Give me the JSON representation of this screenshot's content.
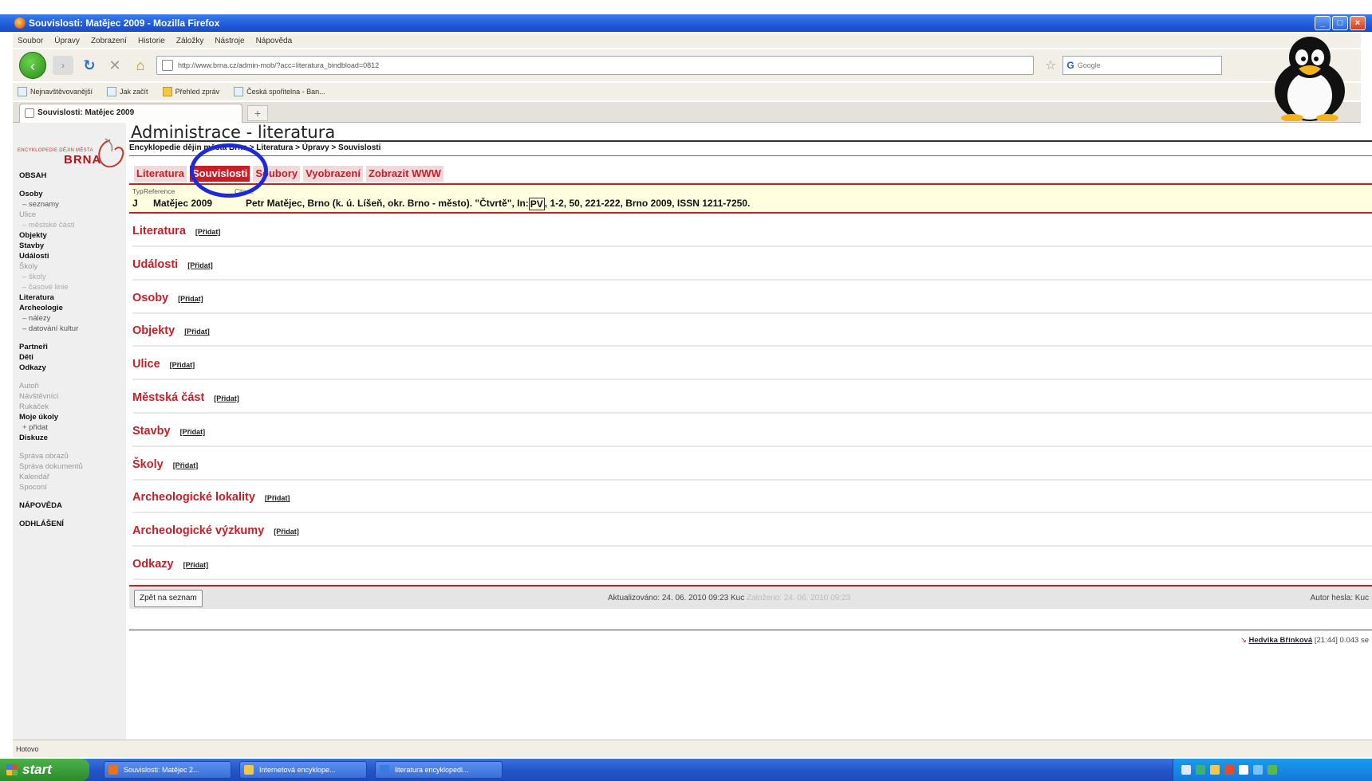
{
  "window": {
    "title": "Souvislosti: Matějec 2009 - Mozilla Firefox",
    "buttons": [
      "_",
      "□",
      "×"
    ]
  },
  "menu": [
    "Soubor",
    "Úpravy",
    "Zobrazení",
    "Historie",
    "Záložky",
    "Nástroje",
    "Nápověda"
  ],
  "navbar": {
    "url": "http://www.brna.cz/admin-mob/?acc=literatura_bindbload=0812",
    "search_placeholder": "Google"
  },
  "bookmarks": [
    "Nejnavštěvovanější",
    "Jak začít",
    "Přehled zpráv",
    "Česká spořitelna - Ban..."
  ],
  "browser_tab": {
    "label": "Souvislosti: Matějec 2009",
    "new_tab": "+"
  },
  "logo": {
    "small": "ENCYKLOPEDIE DĚJIN MĚSTA",
    "brand": "BRNA"
  },
  "sidebar": [
    {
      "label": "OBSAH",
      "style": "b",
      "gap": false
    },
    {
      "label": "Osoby",
      "style": "b",
      "gap": true
    },
    {
      "label": "– seznamy",
      "style": "sub",
      "gap": false
    },
    {
      "label": "Ulice",
      "style": "g",
      "gap": false
    },
    {
      "label": "– městské části",
      "style": "subg",
      "gap": false
    },
    {
      "label": "Objekty",
      "style": "b",
      "gap": false
    },
    {
      "label": "Stavby",
      "style": "b",
      "gap": false
    },
    {
      "label": "Události",
      "style": "b",
      "gap": false
    },
    {
      "label": "Školy",
      "style": "g",
      "gap": false
    },
    {
      "label": "– školy",
      "style": "subg",
      "gap": false
    },
    {
      "label": "– časové linie",
      "style": "subg",
      "gap": false
    },
    {
      "label": "Literatura",
      "style": "b",
      "gap": false
    },
    {
      "label": "Archeologie",
      "style": "b",
      "gap": false
    },
    {
      "label": "– nálezy",
      "style": "sub",
      "gap": false
    },
    {
      "label": "– datování kultur",
      "style": "sub",
      "gap": false
    },
    {
      "label": "Partneři",
      "style": "b",
      "gap": true
    },
    {
      "label": "Děti",
      "style": "b",
      "gap": false
    },
    {
      "label": "Odkazy",
      "style": "b",
      "gap": false
    },
    {
      "label": "Autoři",
      "style": "g",
      "gap": true
    },
    {
      "label": "Návštěvníci",
      "style": "g",
      "gap": false
    },
    {
      "label": "Rukáček",
      "style": "g",
      "gap": false
    },
    {
      "label": "Moje úkoly",
      "style": "b",
      "gap": false
    },
    {
      "label": "+ přidat",
      "style": "sub",
      "gap": false
    },
    {
      "label": "Diskuze",
      "style": "b",
      "gap": false
    },
    {
      "label": "Správa obrazů",
      "style": "g",
      "gap": true
    },
    {
      "label": "Správa dokumentů",
      "style": "g",
      "gap": false
    },
    {
      "label": "Kalendář",
      "style": "g",
      "gap": false
    },
    {
      "label": "Spoconí",
      "style": "g",
      "gap": false
    },
    {
      "label": "NÁPOVĚDA",
      "style": "b",
      "gap": true
    },
    {
      "label": "ODHLÁŠENÍ",
      "style": "b",
      "gap": true
    }
  ],
  "page": {
    "title": "Administrace - literatura",
    "breadcrumb": "Encyklopedie dějin města Brna > Literatura > Úpravy > Souvislosti"
  },
  "tabs": [
    {
      "label": "Literatura",
      "active": false
    },
    {
      "label": "Souvislosti",
      "active": true
    },
    {
      "label": "Soubory",
      "active": false
    },
    {
      "label": "Vyobrazení",
      "active": false
    },
    {
      "label": "Zobrazit WWW",
      "active": false
    }
  ],
  "reference": {
    "headers": [
      "Typ",
      "Reference",
      "Citace"
    ],
    "type": "J",
    "ref": "Matějec 2009",
    "citation_pre": "Petr Matějec, Brno (k. ú. Líšeň, okr. Brno - město). \"Čtvrtě\", In: ",
    "citation_pv": "PV",
    "citation_post": ", 1-2, 50, 221-222, Brno 2009, ISSN 1211-7250."
  },
  "add_label": "[Přidat]",
  "sections": [
    "Literatura",
    "Události",
    "Osoby",
    "Objekty",
    "Ulice",
    "Městská část",
    "Stavby",
    "Školy",
    "Archeologické lokality",
    "Archeologické výzkumy",
    "Odkazy"
  ],
  "footer": {
    "back_button": "Zpět na seznam",
    "updated": "Aktualizováno: 24. 06. 2010 09:23 Kuc",
    "created": "Založeno: 24. 06. 2010 09:23",
    "author_pw": "Autor hesla: Kuc",
    "signature_name": "Hedvika Břínková",
    "signature_time": "[21:44] 0.043 se"
  },
  "statusbar": "Hotovo",
  "taskbar": {
    "start": "start",
    "items": [
      "Souvislosti: Matějec 2...",
      "Internetová encyklope...",
      "literatura encyklopedi..."
    ]
  }
}
